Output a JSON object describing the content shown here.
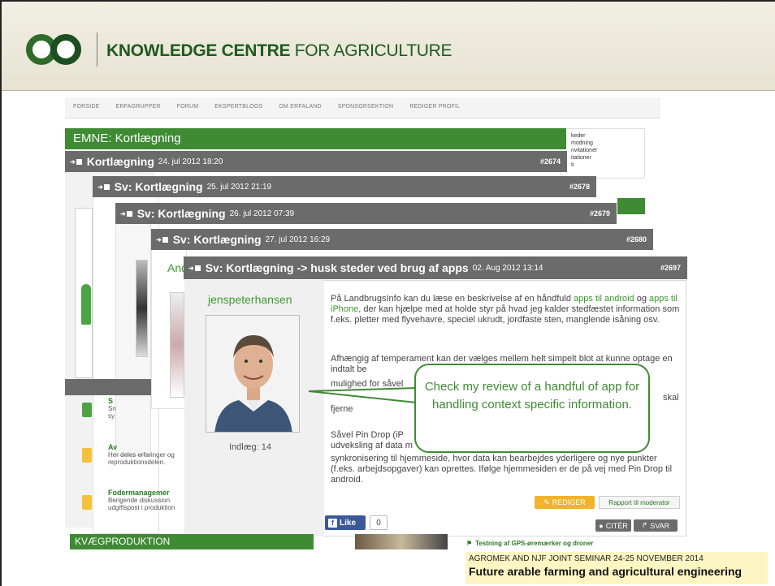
{
  "brand": {
    "bold": "KNOWLEDGE CENTRE",
    "rest": " FOR AGRICULTURE"
  },
  "nav": [
    "FORSIDE",
    "ERFAGRUPPER",
    "FORUM",
    "EKSPERTBLOGS",
    "OM ERFALAND",
    "SPONSORSEKTION",
    "REDIGER PROFIL"
  ],
  "right_box": [
    "keder",
    "modning",
    "nvitationer",
    "itationer",
    "ti"
  ],
  "emne": "EMNE: Kortlægning",
  "threads": [
    {
      "title": "Kortlægning",
      "date": "24. jul 2012 18:20",
      "num": "#2674"
    },
    {
      "title": "Sv: Kortlægning",
      "date": "25. jul 2012 21:19",
      "num": "#2678"
    },
    {
      "title": "Sv: Kortlægning",
      "date": "26. jul 2012 07:39",
      "num": "#2679"
    },
    {
      "title": "Sv: Kortlægning",
      "date": "27. jul 2012 16:29",
      "num": "#2680"
    },
    {
      "title": "Sv: Kortlægning -> husk steder ved brug af apps",
      "date": "02. Aug 2012 13:14",
      "num": "#2697"
    }
  ],
  "partial_text": "And",
  "left_items": [
    {
      "title": "S",
      "desc1": "Sn",
      "desc2": "sy"
    },
    {
      "title": "Av",
      "desc1": "Her deles erfaringer og",
      "desc2": "reproduktionsdelen."
    },
    {
      "title": "Fodermanagemer",
      "desc1": "Berigende diskussion",
      "desc2": "udgiftspost i produktion"
    }
  ],
  "post": {
    "username": "jenspeterhansen",
    "posts": "Indlæg: 14",
    "p1_a": "På LandbrugsInfo kan du læse en beskrivelse af en håndfuld ",
    "p1_link1": "apps til android",
    "p1_b": " og ",
    "p1_link2": "apps til iPhone",
    "p1_c": ", der kan hjælpe med at holde styr på hvad jeg kalder stedfæstet information som f.eks. pletter med flyvehavre, speciel ukrudt, jordfaste sten, manglende isåning osv.",
    "p2": "Afhængig af temperament kan der vælges mellem helt simpelt blot at kunne optage en indtalt be",
    "p2b": "mulighed for såvel",
    "p2c": "skal",
    "p2d": "fjerne",
    "p3a": "Såvel Pin Drop (iP",
    "p3b": "udveksling af data m",
    "p3c": "synkronisering til hjemmeside, hvor data kan bearbejdes yderligere og nye punkter (f.eks. arbejdsopgaver) kan oprettes. Ifølge hjemmesiden er de på vej med Pin Drop til android."
  },
  "callout": "Check my review of a handful of app for handling context specific information.",
  "buttons": {
    "rediger": "REDIGER",
    "rapport": "Rapport til moderator",
    "like": "Like",
    "like_count": "0",
    "cite": "CITÉR",
    "svar": "SVAR"
  },
  "kvaeg": "KVÆGPRODUKTION",
  "news": "Testning af GPS-øremærker og droner",
  "caption": {
    "line1": "AGROMEK AND NJF JOINT SEMINAR 24-25 NOVEMBER 2014",
    "line2": "Future arable farming and agricultural engineering"
  },
  "colors": {
    "green": "#3e8b34",
    "bar": "#6b6b6b",
    "link": "#3a9a2e",
    "accent": "#f0b32b"
  }
}
